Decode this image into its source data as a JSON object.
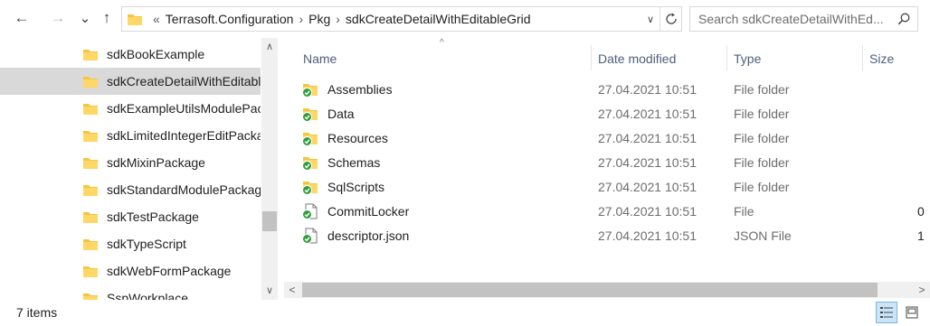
{
  "toolbar": {
    "back_glyph": "←",
    "forward_glyph": "→",
    "recent_glyph": "⌄",
    "up_glyph": "↑"
  },
  "address": {
    "overflow_glyph": "«",
    "separator": "›",
    "crumbs": [
      "Terrasoft.Configuration",
      "Pkg",
      "sdkCreateDetailWithEditableGrid"
    ],
    "dropdown_glyph": "∨"
  },
  "search": {
    "placeholder": "Search sdkCreateDetailWithEd..."
  },
  "nav": {
    "items": [
      {
        "label": "sdkBookExample"
      },
      {
        "label": "sdkCreateDetailWithEditableGrid",
        "selected": true
      },
      {
        "label": "sdkExampleUtilsModulePackage"
      },
      {
        "label": "sdkLimitedIntegerEditPackage"
      },
      {
        "label": "sdkMixinPackage"
      },
      {
        "label": "sdkStandardModulePackage"
      },
      {
        "label": "sdkTestPackage"
      },
      {
        "label": "sdkTypeScript"
      },
      {
        "label": "sdkWebFormPackage"
      },
      {
        "label": "SspWorkplace"
      }
    ],
    "scroll_up": "∧",
    "scroll_down": "∨"
  },
  "list": {
    "sort_indicator": "^",
    "columns": {
      "name": "Name",
      "date": "Date modified",
      "type": "Type",
      "size": "Size"
    },
    "rows": [
      {
        "name": "Assemblies",
        "date": "27.04.2021 10:51",
        "type": "File folder",
        "size": "",
        "kind": "folder"
      },
      {
        "name": "Data",
        "date": "27.04.2021 10:51",
        "type": "File folder",
        "size": "",
        "kind": "folder"
      },
      {
        "name": "Resources",
        "date": "27.04.2021 10:51",
        "type": "File folder",
        "size": "",
        "kind": "folder"
      },
      {
        "name": "Schemas",
        "date": "27.04.2021 10:51",
        "type": "File folder",
        "size": "",
        "kind": "folder"
      },
      {
        "name": "SqlScripts",
        "date": "27.04.2021 10:51",
        "type": "File folder",
        "size": "",
        "kind": "folder"
      },
      {
        "name": "CommitLocker",
        "date": "27.04.2021 10:51",
        "type": "File",
        "size": "0",
        "kind": "file"
      },
      {
        "name": "descriptor.json",
        "date": "27.04.2021 10:51",
        "type": "JSON File",
        "size": "1",
        "kind": "file"
      }
    ],
    "scroll_left": "<",
    "scroll_right": ">"
  },
  "status": {
    "item_count": "7 items"
  },
  "colors": {
    "folder_yellow": "#f4c542",
    "sync_green": "#2e9e3c",
    "header_text": "#4c607a",
    "selection": "#d9d9d9",
    "scrollbar_track": "#f0f0f0",
    "scrollbar_thumb": "#c2c2c2"
  }
}
